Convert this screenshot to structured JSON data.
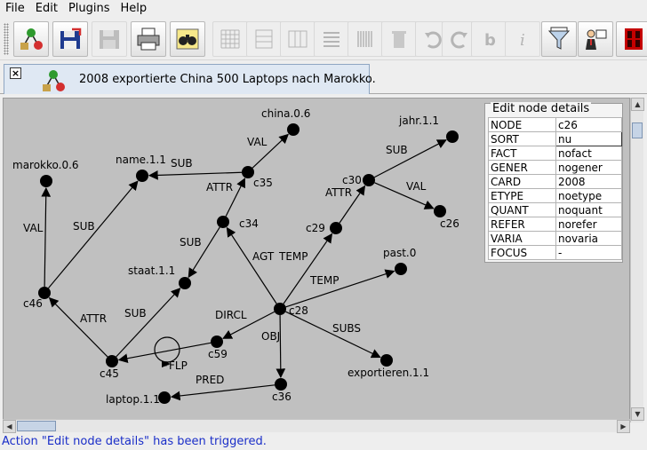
{
  "menu": [
    "File",
    "Edit",
    "Plugins",
    "Help"
  ],
  "toolbar": {
    "buttons": [
      {
        "name": "new-graph-button",
        "icon": "tree-icon",
        "enabled": true
      },
      {
        "name": "open-button",
        "icon": "floppy-open-icon",
        "enabled": true
      },
      {
        "name": "save-button",
        "icon": "floppy-icon",
        "enabled": false
      },
      {
        "name": "print-button",
        "icon": "printer-icon",
        "enabled": true
      },
      {
        "name": "find-button",
        "icon": "binoculars-icon",
        "enabled": true
      },
      {
        "name": "grid-button",
        "icon": "grid-icon",
        "enabled": false
      },
      {
        "name": "horizontal-layout-button",
        "icon": "horizontal-split-icon",
        "enabled": false
      },
      {
        "name": "vertical-layout-button",
        "icon": "vertical-split-icon",
        "enabled": false
      },
      {
        "name": "align-button",
        "icon": "lines-icon",
        "enabled": false
      },
      {
        "name": "barcode-button",
        "icon": "barcode-icon",
        "enabled": false
      },
      {
        "name": "delete-button",
        "icon": "trash-icon",
        "enabled": false
      },
      {
        "name": "undo-button",
        "icon": "undo-icon",
        "enabled": false
      },
      {
        "name": "redo-button",
        "icon": "redo-icon",
        "enabled": false
      },
      {
        "name": "bold-button",
        "icon": "bold-b-icon",
        "enabled": false
      },
      {
        "name": "info-button",
        "icon": "info-i-icon",
        "enabled": false
      },
      {
        "name": "filter-button",
        "icon": "funnel-icon",
        "enabled": true
      },
      {
        "name": "teacher-button",
        "icon": "presenter-icon",
        "enabled": true
      },
      {
        "name": "display-button",
        "icon": "led-display-icon",
        "enabled": true
      }
    ]
  },
  "tab": {
    "label": "2008 exportierte China 500 Laptops nach Marokko."
  },
  "graph": {
    "nodes": [
      {
        "id": "china.0.6",
        "label": "china.0.6"
      },
      {
        "id": "jahr.1.1",
        "label": "jahr.1.1"
      },
      {
        "id": "marokko.0.6",
        "label": "marokko.0.6"
      },
      {
        "id": "name.1.1",
        "label": "name.1.1"
      },
      {
        "id": "c35",
        "label": "c35"
      },
      {
        "id": "c30",
        "label": "c30"
      },
      {
        "id": "c34",
        "label": "c34"
      },
      {
        "id": "c29",
        "label": "c29"
      },
      {
        "id": "c26",
        "label": "c26"
      },
      {
        "id": "past.0",
        "label": "past.0"
      },
      {
        "id": "staat.1.1",
        "label": "staat.1.1"
      },
      {
        "id": "c46",
        "label": "c46"
      },
      {
        "id": "c28",
        "label": "c28"
      },
      {
        "id": "c59",
        "label": "c59"
      },
      {
        "id": "c45",
        "label": "c45"
      },
      {
        "id": "exportieren.1.1",
        "label": "exportieren.1.1"
      },
      {
        "id": "c36",
        "label": "c36"
      },
      {
        "id": "laptop.1.1",
        "label": "laptop.1.1"
      }
    ],
    "edges": [
      {
        "from": "c35",
        "to": "china.0.6",
        "label": "VAL"
      },
      {
        "from": "c35",
        "to": "name.1.1",
        "label": "SUB"
      },
      {
        "from": "c34",
        "to": "c35",
        "label": "ATTR"
      },
      {
        "from": "c34",
        "to": "staat.1.1",
        "label": "SUB"
      },
      {
        "from": "c30",
        "to": "jahr.1.1",
        "label": "SUB"
      },
      {
        "from": "c30",
        "to": "c26",
        "label": "VAL"
      },
      {
        "from": "c29",
        "to": "c30",
        "label": "ATTR"
      },
      {
        "from": "c46",
        "to": "marokko.0.6",
        "label": "VAL"
      },
      {
        "from": "c46",
        "to": "name.1.1",
        "label": "SUB"
      },
      {
        "from": "c28",
        "to": "c34",
        "label": "AGT"
      },
      {
        "from": "c28",
        "to": "c29",
        "label": "TEMP"
      },
      {
        "from": "c28",
        "to": "past.0",
        "label": "TEMP"
      },
      {
        "from": "c28",
        "to": "c59",
        "label": "DIRCL"
      },
      {
        "from": "c28",
        "to": "c36",
        "label": "OBJ"
      },
      {
        "from": "c28",
        "to": "exportieren.1.1",
        "label": "SUBS"
      },
      {
        "from": "c45",
        "to": "c46",
        "label": "ATTR"
      },
      {
        "from": "c45",
        "to": "staat.1.1",
        "label": "SUB"
      },
      {
        "from": "c59",
        "to": "c45",
        "label": ""
      },
      {
        "from": "c45",
        "to": "c45",
        "label": "*FLP"
      },
      {
        "from": "c36",
        "to": "laptop.1.1",
        "label": "PRED"
      }
    ]
  },
  "details": {
    "title": "Edit node details",
    "rows": [
      {
        "key": "NODE",
        "value": "c26"
      },
      {
        "key": "SORT",
        "value": "nu"
      },
      {
        "key": "FACT",
        "value": "nofact"
      },
      {
        "key": "GENER",
        "value": "nogener"
      },
      {
        "key": "CARD",
        "value": "2008"
      },
      {
        "key": "ETYPE",
        "value": "noetype"
      },
      {
        "key": "QUANT",
        "value": "noquant"
      },
      {
        "key": "REFER",
        "value": "norefer"
      },
      {
        "key": "VARIA",
        "value": "novaria"
      },
      {
        "key": "FOCUS",
        "value": "-"
      }
    ]
  },
  "status": {
    "text": "Action \"Edit node details\" has been triggered."
  }
}
